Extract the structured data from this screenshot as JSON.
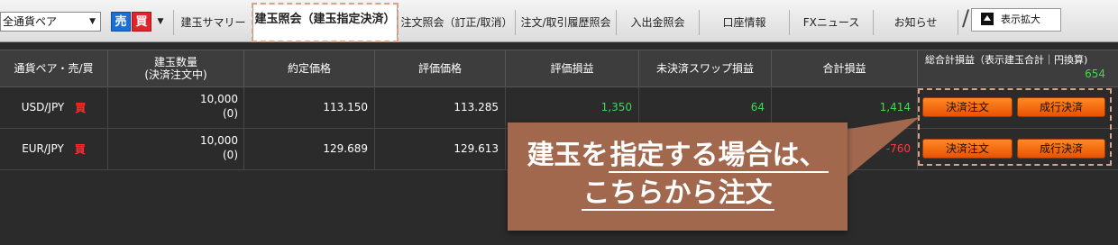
{
  "tabbar": {
    "pair_select": "全通貨ペア",
    "sell_label": "売",
    "buy_label": "買",
    "tabs": [
      "建玉サマリー",
      "建玉照会（建玉指定決済）",
      "注文照会（訂正/取消）",
      "注文/取引履歴照会",
      "入出金照会",
      "口座情報",
      "FXニュース",
      "お知らせ"
    ],
    "expand_label": "表示拡大"
  },
  "table": {
    "headers": [
      "通貨ペア・売/買",
      "建玉数量\n(決済注文中)",
      "約定価格",
      "評価価格",
      "評価損益",
      "未決済スワップ損益",
      "合計損益",
      "総合計損益（表示建玉合計｜円換算)"
    ],
    "total_value": "654",
    "rows": [
      {
        "pair": "USD/JPY",
        "side": "買",
        "qty": "10,000",
        "pending": "(0)",
        "exec_price": "113.150",
        "eval_price": "113.285",
        "eval_pl": "1,350",
        "swap_pl": "64",
        "total_pl": "1,414"
      },
      {
        "pair": "EUR/JPY",
        "side": "買",
        "qty": "10,000",
        "pending": "(0)",
        "exec_price": "129.689",
        "eval_price": "129.613",
        "eval_pl": "",
        "swap_pl": "",
        "total_pl": "-760"
      }
    ],
    "btn_settle": "決済注文",
    "btn_market": "成行決済"
  },
  "callout": {
    "line1_part1": "建玉を",
    "line1_underlined": "指定する場合は、",
    "line2_underlined": "こちらから注文"
  },
  "colors": {
    "callout_bg": "#a1684e",
    "profit_green": "#3ed94f",
    "loss_red": "#ff3a3a",
    "action_orange": "#ff7a14",
    "dashed_highlight": "#d9a387"
  }
}
